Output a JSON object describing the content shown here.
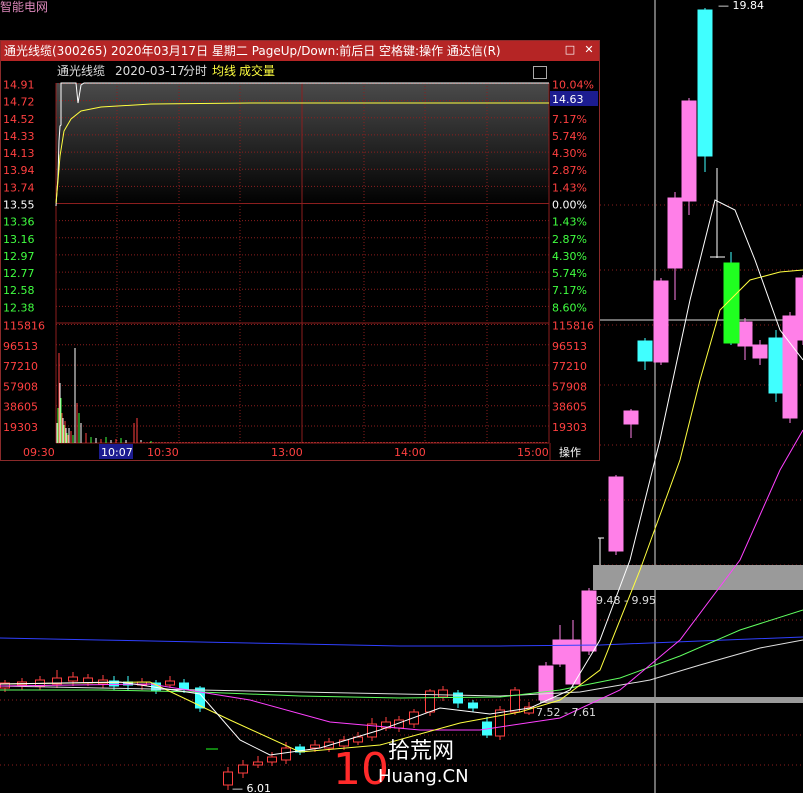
{
  "site_tag": "智能电网",
  "window": {
    "title": "通光线缆(300265) 2020年03月17日 星期二 PageUp/Down:前后日 空格键:操作 通达信(R)",
    "maximize_icon": "square-icon",
    "close_icon": "close-icon"
  },
  "infobar": {
    "stock": "通光线缆",
    "date": "2020-03-17",
    "mode": "分时",
    "avg_label": "均线",
    "vol_label": "成交量"
  },
  "price_axis": {
    "left": [
      "14.91",
      "14.72",
      "14.52",
      "14.33",
      "14.13",
      "13.94",
      "13.74",
      "13.55",
      "13.36",
      "13.16",
      "12.97",
      "12.77",
      "12.58",
      "12.38"
    ],
    "right": [
      "10.04%",
      "8.60%",
      "7.17%",
      "5.74%",
      "4.30%",
      "2.87%",
      "1.43%",
      "0.00%",
      "1.43%",
      "2.87%",
      "4.30%",
      "5.74%",
      "7.17%",
      "8.60%"
    ],
    "current_price": "14.63"
  },
  "volume_axis": [
    "115816",
    "96513",
    "77210",
    "57908",
    "38605",
    "19303"
  ],
  "time_axis": [
    "09:30",
    "10:07",
    "10:30",
    "13:00",
    "14:00",
    "15:00"
  ],
  "operate_label": "操作",
  "kline": {
    "high_label": "19.84",
    "low_label": "6.01",
    "range1": "9.48 - 9.95",
    "range2": "7.52 - 7.61"
  },
  "colors": {
    "up": "#ff4040",
    "down": "#40ffff",
    "title_bg": "#b52525",
    "yellow": "#ffff40"
  },
  "watermark": {
    "number": "10",
    "text": "拾荒网",
    "domain": "Huang.CN"
  }
}
